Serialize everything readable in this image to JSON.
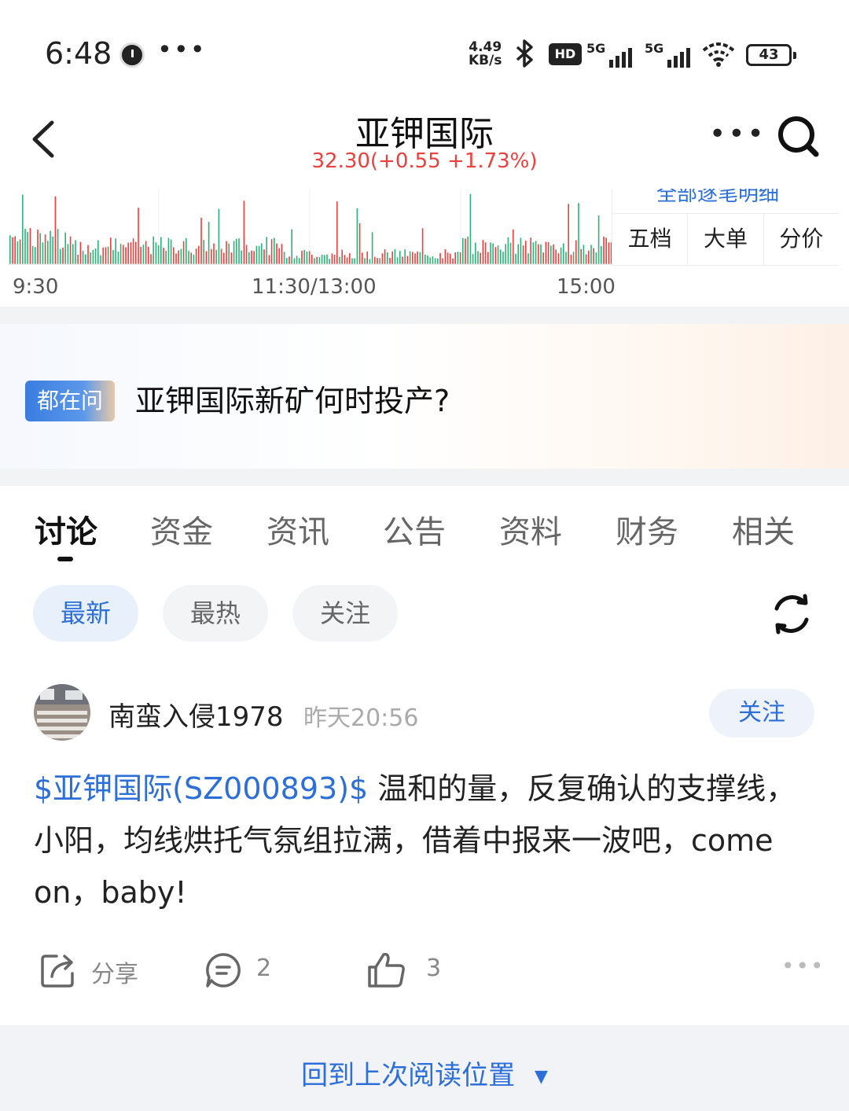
{
  "status_bar": {
    "time": "6:48",
    "more": "•••",
    "speed_value": "4.49",
    "speed_unit": "KB/s",
    "hd": "HD",
    "net1": "5G",
    "net2": "5G",
    "battery": "43"
  },
  "header": {
    "title": "亚钾国际",
    "price_line": "32.30(+0.55 +1.73%)",
    "more": "•••"
  },
  "chart": {
    "time_labels": [
      "9:30",
      "11:30/13:00",
      "15:00"
    ],
    "side_top_text": "全部逐笔明细",
    "side_tabs": [
      "五档",
      "大单",
      "分价"
    ]
  },
  "colors": {
    "up": "#e8413e",
    "down": "#2bb37a",
    "accent": "#2d6fd9"
  },
  "banner": {
    "tag": "都在问",
    "question": "亚钾国际新矿何时投产?"
  },
  "tabs": [
    "讨论",
    "资金",
    "资讯",
    "公告",
    "资料",
    "财务",
    "相关"
  ],
  "filters": [
    "最新",
    "最热",
    "关注"
  ],
  "post": {
    "username": "南蛮入侵1978",
    "time": "昨天20:56",
    "follow": "关注",
    "stock_tag": "$亚钾国际(SZ000893)$",
    "content": " 温和的量，反复确认的支撑线，小阳，均线烘托气氛组拉满，借着中报来一波吧，come on，baby!",
    "share": "分享",
    "comments": "2",
    "likes": "3"
  },
  "bottom_bar": {
    "text": "回到上次阅读位置",
    "arrow": "▼"
  }
}
